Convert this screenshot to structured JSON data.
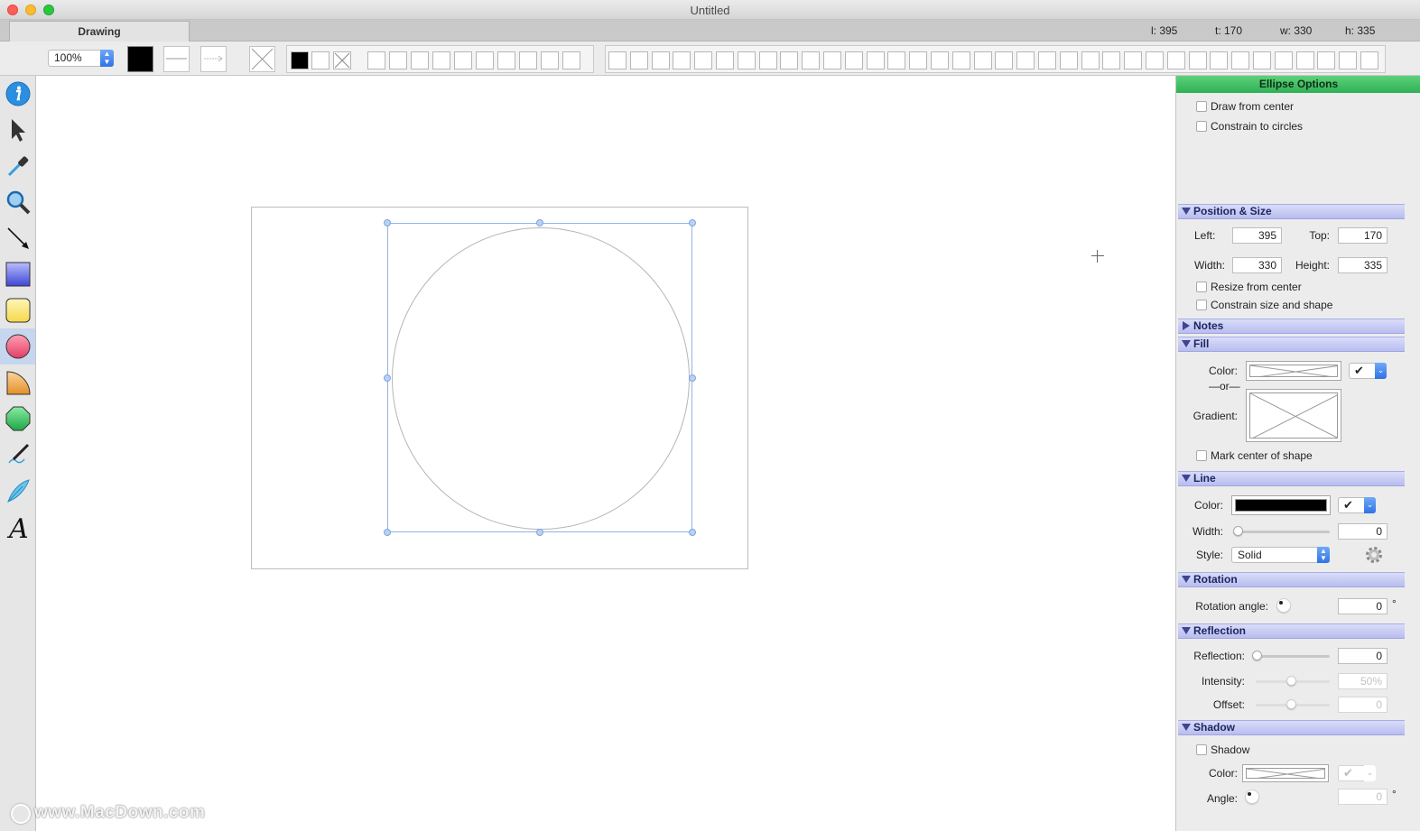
{
  "window": {
    "title": "Untitled"
  },
  "tabs": {
    "active": "Drawing"
  },
  "coords": {
    "l": "l: 395",
    "t": "t: 170",
    "w": "w: 330",
    "h": "h: 335"
  },
  "toolbar": {
    "zoom": "100%"
  },
  "tools": [
    "info-icon",
    "arrow-select-icon",
    "eyedropper-icon",
    "magnifier-icon",
    "line-icon",
    "rectangle-icon",
    "rounded-rectangle-icon",
    "ellipse-icon",
    "pie-icon",
    "polygon-icon",
    "pen-icon",
    "quill-icon",
    "text-icon"
  ],
  "inspector": {
    "title": "Ellipse Options",
    "draw_from_center": "Draw from center",
    "constrain_to_circles": "Constrain to circles",
    "position_size": {
      "header": "Position & Size",
      "left_label": "Left:",
      "left": "395",
      "top_label": "Top:",
      "top": "170",
      "width_label": "Width:",
      "width": "330",
      "height_label": "Height:",
      "height": "335",
      "resize_from_center": "Resize from center",
      "constrain_size": "Constrain size and shape"
    },
    "notes": {
      "header": "Notes"
    },
    "fill": {
      "header": "Fill",
      "color_label": "Color:",
      "or_label": "—or—",
      "gradient_label": "Gradient:",
      "mark_center": "Mark center of shape",
      "check": "✔"
    },
    "line": {
      "header": "Line",
      "color_label": "Color:",
      "color": "#000000",
      "width_label": "Width:",
      "width": "0",
      "style_label": "Style:",
      "style": "Solid",
      "check": "✔"
    },
    "rotation": {
      "header": "Rotation",
      "angle_label": "Rotation angle:",
      "angle": "0",
      "degree": "°"
    },
    "reflection": {
      "header": "Reflection",
      "reflection_label": "Reflection:",
      "reflection": "0",
      "intensity_label": "Intensity:",
      "intensity": "50%",
      "offset_label": "Offset:",
      "offset": "0"
    },
    "shadow": {
      "header": "Shadow",
      "shadow_label": "Shadow",
      "color_label": "Color:",
      "angle_label": "Angle:",
      "angle": "0",
      "degree": "°",
      "check": "✔"
    }
  },
  "watermark": {
    "text": "www.MacDown.com"
  },
  "colors": {
    "accent": "#2f74e6",
    "inspector_title": "#2eb056",
    "section": "#b8bdf0"
  }
}
